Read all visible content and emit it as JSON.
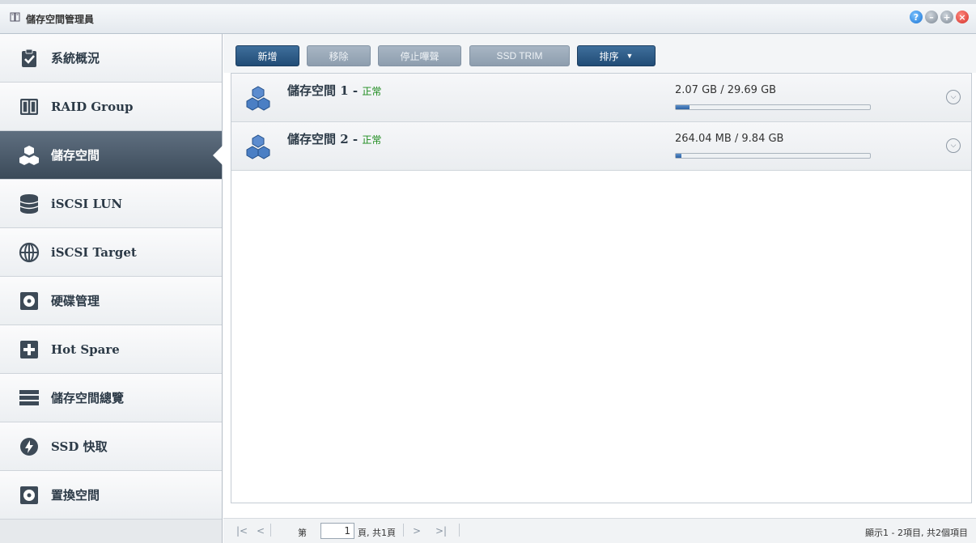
{
  "window": {
    "title": "儲存空間管理員"
  },
  "sidebar": {
    "items": [
      {
        "label": "系統概況"
      },
      {
        "label": "RAID Group"
      },
      {
        "label": "儲存空間"
      },
      {
        "label": "iSCSI LUN"
      },
      {
        "label": "iSCSI Target"
      },
      {
        "label": "硬碟管理"
      },
      {
        "label": "Hot Spare"
      },
      {
        "label": "儲存空間總覽"
      },
      {
        "label": "SSD 快取"
      },
      {
        "label": "置換空間"
      }
    ],
    "active_index": 2
  },
  "toolbar": {
    "create_label": "新增",
    "remove_label": "移除",
    "stop_beep_label": "停止嗶聲",
    "ssd_trim_label": "SSD TRIM",
    "sort_label": "排序"
  },
  "volumes": [
    {
      "name": "儲存空間 1",
      "status": "正常",
      "usage": "2.07 GB / 29.69 GB",
      "used_fraction": 0.07
    },
    {
      "name": "儲存空間 2",
      "status": "正常",
      "usage": "264.04 MB / 9.84 GB",
      "used_fraction": 0.03
    }
  ],
  "pagination": {
    "page_prefix": "第",
    "page_value": "1",
    "page_suffix": "頁, 共1頁",
    "summary": "顯示1 - 2項目, 共2個項目"
  },
  "colors": {
    "accent": "#214c76",
    "status_ok": "#1b8a1b",
    "active_nav": "#3b4a59"
  }
}
